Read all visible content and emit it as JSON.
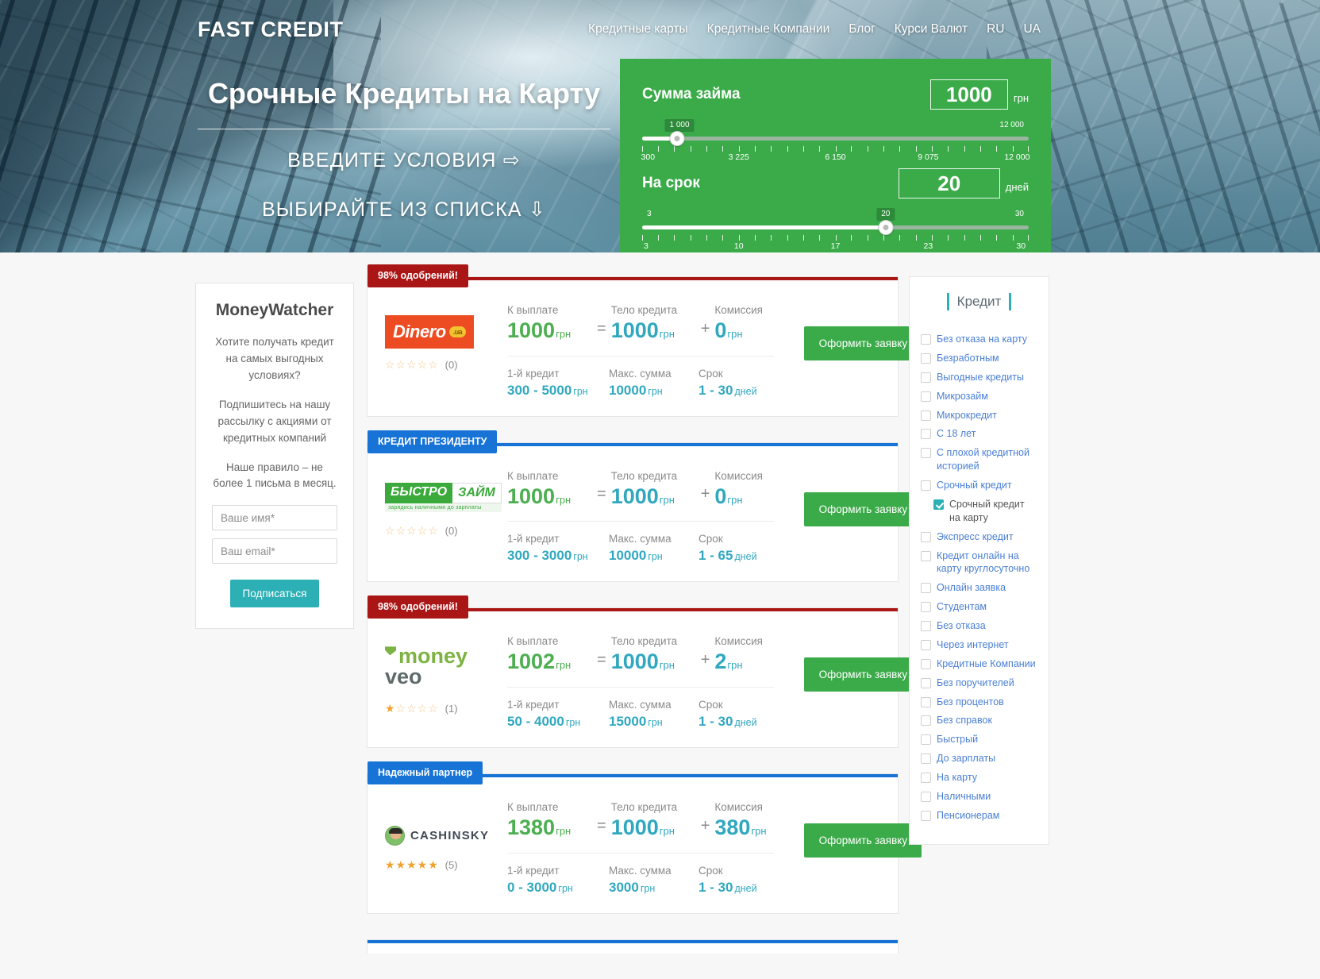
{
  "brand": "FAST CREDIT",
  "nav": [
    {
      "label": "Кредитные карты"
    },
    {
      "label": "Кредитные Компании"
    },
    {
      "label": "Блог"
    },
    {
      "label": "Курси Валют"
    },
    {
      "label": "RU"
    },
    {
      "label": "UA"
    }
  ],
  "hero": {
    "title": "Срочные Кредиты на Карту",
    "line1": "ВВЕДИТЕ УСЛОВИЯ ⇨",
    "line2": "ВЫБИРАЙТЕ ИЗ СПИСКА ⇩"
  },
  "calculator": {
    "amount_label": "Сумма займа",
    "amount_value": "1000",
    "amount_unit": "грн",
    "amount_bubble": "1 000",
    "amount_min_bubble": "1 000",
    "amount_max_bubble": "12 000",
    "amount_ticks": [
      "300",
      "3 225",
      "6 150",
      "9 075",
      "12 000"
    ],
    "term_label": "На срок",
    "term_value": "20",
    "term_unit": "дней",
    "term_bubble": "20",
    "term_min_bubble": "3",
    "term_max_bubble": "30",
    "term_ticks": [
      "3",
      "10",
      "17",
      "23",
      "30"
    ]
  },
  "widget": {
    "title": "MoneyWatcher",
    "p1": "Хотите получать кредит на самых выгодных условиях?",
    "p2": "Подпишитесь на нашу рассылку с акциями от кредитных компаний",
    "p3": "Наше правило – не более 1 письма в месяц.",
    "name_placeholder": "Ваше имя*",
    "email_placeholder": "Ваш email*",
    "button": "Подписаться"
  },
  "labels": {
    "to_pay": "К выплате",
    "body": "Тело кредита",
    "fee": "Комиссия",
    "first_credit": "1-й кредит",
    "max_sum": "Макс. сумма",
    "term": "Срок",
    "apply": "Оформить заявку",
    "uah": "грн",
    "days": "дней"
  },
  "offers": [
    {
      "badge": "98% одобрений!",
      "badge_color": "red",
      "logo": "dinero",
      "logo_text": "Dinero",
      "logo_tag": ".ua",
      "rating": 0,
      "reviews": "(0)",
      "to_pay": "1000",
      "body": "1000",
      "fee": "0",
      "first_credit": "300 - 5000",
      "max_sum": "10000",
      "term": "1 - 30"
    },
    {
      "badge": "КРЕДИТ ПРЕЗИДЕНТУ",
      "badge_color": "blue",
      "logo": "bistrozaim",
      "logo_text_a": "БЫСТРО",
      "logo_text_b": "ЗАЙМ",
      "logo_sub": "зарядись наличными до зарплаты",
      "rating": 0,
      "reviews": "(0)",
      "to_pay": "1000",
      "body": "1000",
      "fee": "0",
      "first_credit": "300 - 3000",
      "max_sum": "10000",
      "term": "1 - 65"
    },
    {
      "badge": "98% одобрений!",
      "badge_color": "red",
      "logo": "moneyveo",
      "logo_text_a": "money",
      "logo_text_b": "veo",
      "rating": 1,
      "reviews": "(1)",
      "to_pay": "1002",
      "body": "1000",
      "fee": "2",
      "first_credit": "50 - 4000",
      "max_sum": "15000",
      "term": "1 - 30"
    },
    {
      "badge": "Надежный партнер",
      "badge_color": "blue",
      "logo": "cashinsky",
      "logo_text": "CASHINSKY",
      "rating": 5,
      "reviews": "(5)",
      "to_pay": "1380",
      "body": "1000",
      "fee": "380",
      "first_credit": "0 - 3000",
      "max_sum": "3000",
      "term": "1 - 30"
    }
  ],
  "filters": {
    "title": "Кредит",
    "items": [
      {
        "label": "Без отказа на карту",
        "checked": false,
        "indent": false
      },
      {
        "label": "Безработным",
        "checked": false,
        "indent": false
      },
      {
        "label": "Выгодные кредиты",
        "checked": false,
        "indent": false
      },
      {
        "label": "Микрозайм",
        "checked": false,
        "indent": false
      },
      {
        "label": "Микрокредит",
        "checked": false,
        "indent": false
      },
      {
        "label": "С 18 лет",
        "checked": false,
        "indent": false
      },
      {
        "label": "С плохой кредитной историей",
        "checked": false,
        "indent": false
      },
      {
        "label": "Срочный кредит",
        "checked": false,
        "indent": false
      },
      {
        "label": "Срочный кредит на карту",
        "checked": true,
        "indent": true
      },
      {
        "label": "Экспресс кредит",
        "checked": false,
        "indent": false
      },
      {
        "label": "Кредит онлайн на карту круглосуточно",
        "checked": false,
        "indent": false
      },
      {
        "label": "Онлайн заявка",
        "checked": false,
        "indent": false
      },
      {
        "label": "Студентам",
        "checked": false,
        "indent": false
      },
      {
        "label": "Без отказа",
        "checked": false,
        "indent": false
      },
      {
        "label": "Через интернет",
        "checked": false,
        "indent": false
      },
      {
        "label": "Кредитные Компании",
        "checked": false,
        "indent": false
      },
      {
        "label": "Без поручителей",
        "checked": false,
        "indent": false
      },
      {
        "label": "Без процентов",
        "checked": false,
        "indent": false
      },
      {
        "label": "Без справок",
        "checked": false,
        "indent": false
      },
      {
        "label": "Быстрый",
        "checked": false,
        "indent": false
      },
      {
        "label": "До зарплаты",
        "checked": false,
        "indent": false
      },
      {
        "label": "На карту",
        "checked": false,
        "indent": false
      },
      {
        "label": "Наличными",
        "checked": false,
        "indent": false
      },
      {
        "label": "Пенсионерам",
        "checked": false,
        "indent": false
      }
    ]
  },
  "colors": {
    "green": "#3bab49",
    "teal": "#2cb0b5",
    "red_badge": "#aa1515",
    "blue_badge": "#1773d6",
    "value_green": "#4caf50",
    "value_teal": "#31a8bf"
  }
}
